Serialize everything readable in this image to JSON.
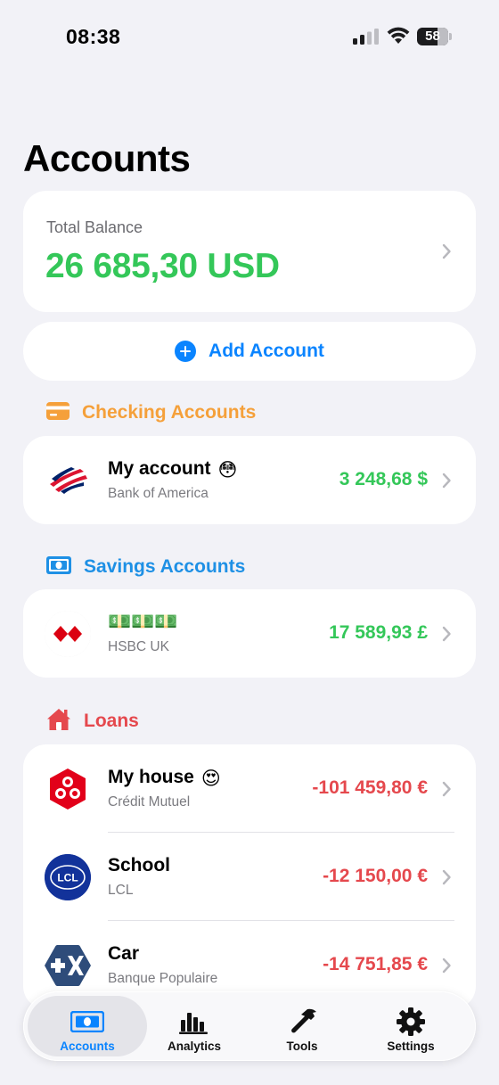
{
  "status_bar": {
    "time": "08:38",
    "battery": "58"
  },
  "page_title": "Accounts",
  "total": {
    "label": "Total Balance",
    "value": "26 685,30 USD"
  },
  "add_account": {
    "label": "Add Account"
  },
  "sections": {
    "checking": {
      "title": "Checking Accounts",
      "color": "#F5A03A",
      "icon": "card-icon"
    },
    "savings": {
      "title": "Savings Accounts",
      "color": "#1E90E5",
      "icon": "banknote-icon"
    },
    "loans": {
      "title": "Loans",
      "color": "#E5484D",
      "icon": "house-icon"
    }
  },
  "accounts": {
    "checking": [
      {
        "name": "My account",
        "emoji": "😳",
        "bank": "Bank of America",
        "amount": "3 248,68 $",
        "logo": "bank-of-america-logo"
      }
    ],
    "savings": [
      {
        "name": "💵💵💵",
        "emoji": "",
        "bank": "HSBC UK",
        "amount": "17 589,93 £",
        "logo": "hsbc-logo"
      }
    ],
    "loans": [
      {
        "name": "My house",
        "emoji": "😍",
        "bank": "Crédit Mutuel",
        "amount": "-101 459,80 €",
        "logo": "credit-mutuel-logo"
      },
      {
        "name": "School",
        "emoji": "",
        "bank": "LCL",
        "amount": "-12 150,00 €",
        "logo": "lcl-logo"
      },
      {
        "name": "Car",
        "emoji": "",
        "bank": "Banque Populaire",
        "amount": "-14 751,85 €",
        "logo": "banque-populaire-logo"
      }
    ]
  },
  "tabs": [
    {
      "label": "Accounts",
      "icon": "banknote-icon",
      "active": true
    },
    {
      "label": "Analytics",
      "icon": "bar-chart-icon",
      "active": false
    },
    {
      "label": "Tools",
      "icon": "hammer-icon",
      "active": false
    },
    {
      "label": "Settings",
      "icon": "gear-icon",
      "active": false
    }
  ],
  "colors": {
    "positive": "#34C759",
    "negative": "#E5484D",
    "accent": "#0A84FF",
    "background": "#F2F2F7"
  }
}
